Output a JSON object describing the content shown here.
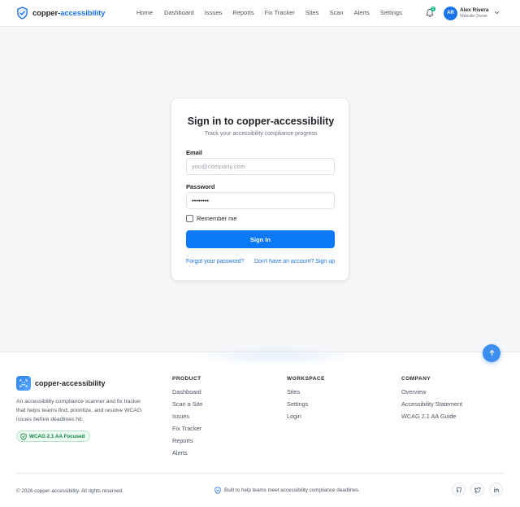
{
  "header": {
    "brand_prefix": "copper-",
    "brand_accent": "accessibility",
    "nav": [
      "Home",
      "Dashboard",
      "Issues",
      "Reports",
      "Fix Tracker",
      "Sites",
      "Scan",
      "Alerts",
      "Settings"
    ],
    "notification_count": "1",
    "user": {
      "initials": "AR",
      "name": "Alex Rivera",
      "role": "Website Owner"
    }
  },
  "signin": {
    "title": "Sign in to copper-accessibility",
    "subtitle": "Track your accessibility compliance progress",
    "email_label": "Email",
    "email_placeholder": "you@company.com",
    "password_label": "Password",
    "password_value": "••••••••",
    "remember_label": "Remember me",
    "submit_label": "Sign In",
    "forgot_link": "Forgot your password?",
    "signup_link": "Don't have an account? Sign up"
  },
  "footer": {
    "brand": "copper-accessibility",
    "description": "An accessibility compliance scanner and fix tracker that helps teams find, prioritize, and resolve WCAG issues before deadlines hit.",
    "badge": "WCAG 2.1 AA Focused",
    "columns": [
      {
        "title": "PRODUCT",
        "links": [
          "Dashboard",
          "Scan a Site",
          "Issues",
          "Fix Tracker",
          "Reports",
          "Alerts"
        ]
      },
      {
        "title": "WORKSPACE",
        "links": [
          "Sites",
          "Settings",
          "Login"
        ]
      },
      {
        "title": "COMPANY",
        "links": [
          "Overview",
          "Accessibility Statement",
          "WCAG 2.1 AA Guide"
        ]
      }
    ],
    "copyright": "© 2026 copper-accessibility. All rights reserved.",
    "built": "Built to help teams meet accessibility compliance deadlines.",
    "social": [
      "github-icon",
      "twitter-icon",
      "linkedin-icon"
    ]
  },
  "colors": {
    "accent": "#1a73e8",
    "button": "#0b78f5",
    "badge_green": "#15803d"
  }
}
